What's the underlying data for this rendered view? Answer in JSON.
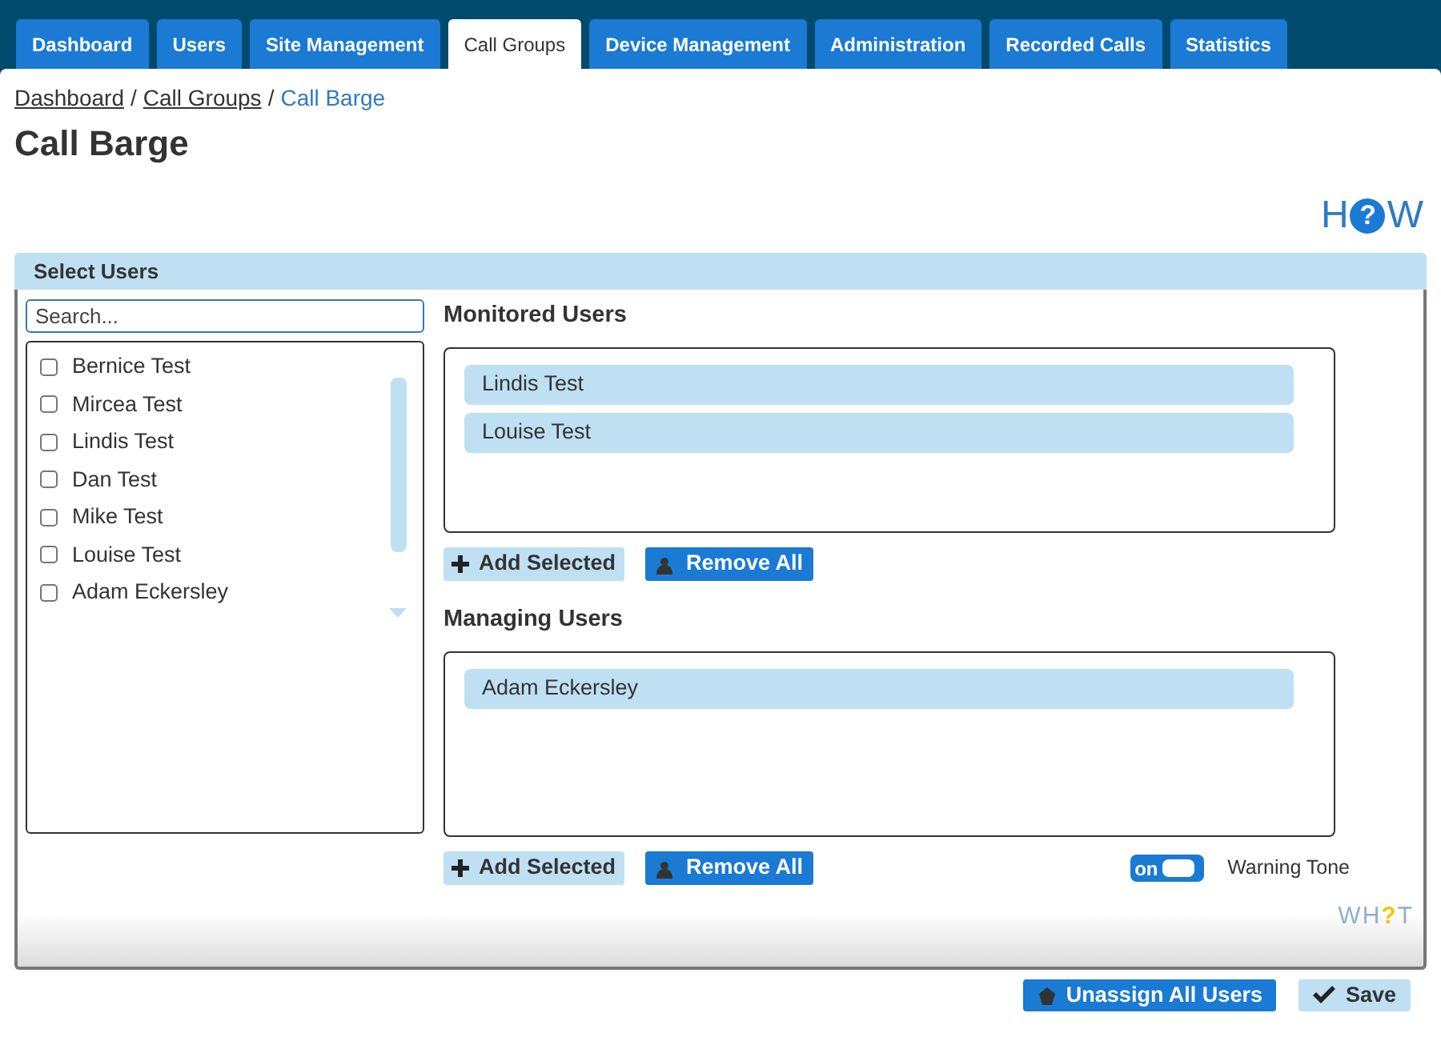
{
  "tabs": [
    {
      "label": "Dashboard",
      "selected": false
    },
    {
      "label": "Users",
      "selected": false
    },
    {
      "label": "Site Management",
      "selected": false
    },
    {
      "label": "Call Groups",
      "selected": true
    },
    {
      "label": "Device Management",
      "selected": false
    },
    {
      "label": "Administration",
      "selected": false
    },
    {
      "label": "Recorded Calls",
      "selected": false
    },
    {
      "label": "Statistics",
      "selected": false
    }
  ],
  "breadcrumb": {
    "links": [
      "Dashboard",
      "Call Groups"
    ],
    "separator": "/",
    "current": "Call Barge"
  },
  "page_title": "Call Barge",
  "help_logo": {
    "before": "H",
    "mark": "?",
    "after": "W"
  },
  "panel": {
    "title": "Select Users",
    "search": {
      "placeholder": "Search..."
    },
    "users": [
      {
        "name": "Bernice Test",
        "checked": false
      },
      {
        "name": "Mircea Test",
        "checked": false
      },
      {
        "name": "Lindis Test",
        "checked": false
      },
      {
        "name": "Dan Test",
        "checked": false
      },
      {
        "name": "Mike Test",
        "checked": false
      },
      {
        "name": "Louise Test",
        "checked": false
      },
      {
        "name": "Adam Eckersley",
        "checked": false
      }
    ],
    "groups": [
      {
        "title": "Monitored Users",
        "members": [
          "Lindis Test",
          "Louise Test"
        ],
        "add_label": "Add Selected",
        "remove_label": "Remove All"
      },
      {
        "title": "Managing Users",
        "members": [
          "Adam Eckersley"
        ],
        "add_label": "Add Selected",
        "remove_label": "Remove All"
      }
    ],
    "warning_tone": {
      "on": true,
      "state_label": "on",
      "label": "Warning Tone"
    },
    "what_logo": {
      "before": "WH",
      "mark": "?",
      "after": "T"
    }
  },
  "footer_buttons": [
    {
      "kind": "primary",
      "label": "Unassign All Users"
    },
    {
      "kind": "secondary",
      "label": "Save"
    }
  ]
}
